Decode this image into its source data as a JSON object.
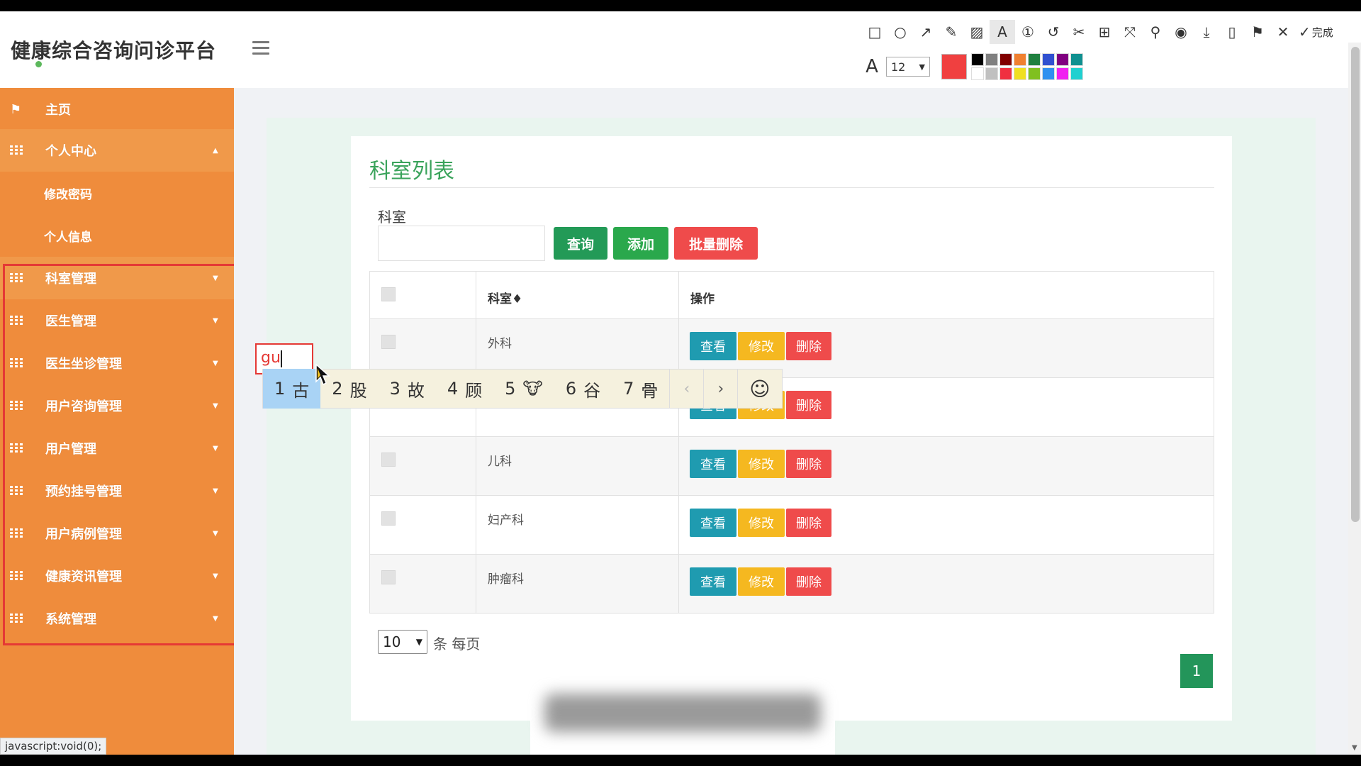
{
  "app": {
    "title": "健康综合咨询问诊平台"
  },
  "avatar": {
    "text": "80x80"
  },
  "annotation_toolbar": {
    "icons": [
      "rect-icon",
      "circle-icon",
      "arrow-icon",
      "pen-icon",
      "mosaic-icon",
      "text-icon",
      "number-icon",
      "undo-icon",
      "crop-icon",
      "translate-icon",
      "ocr-icon",
      "pin-icon",
      "record-icon",
      "download-icon",
      "save-icon",
      "bookmark-icon",
      "close-icon"
    ],
    "done_label": "完成",
    "font_size": "12",
    "current_color": "#f04040",
    "palette": [
      "#000000",
      "#808080",
      "#800000",
      "#f08030",
      "#208040",
      "#3050d0",
      "#800080",
      "#109090",
      "#ffffff",
      "#c0c0c0",
      "#f03040",
      "#f0e020",
      "#80c020",
      "#3090f0",
      "#f020f0",
      "#20d0d0"
    ]
  },
  "sidebar": {
    "items": [
      {
        "label": "主页",
        "icon": "flag-icon",
        "caret": ""
      },
      {
        "label": "个人中心",
        "icon": "grid-icon",
        "caret": "▲"
      },
      {
        "label": "修改密码",
        "sub": true
      },
      {
        "label": "个人信息",
        "sub": true
      },
      {
        "label": "科室管理",
        "icon": "grid-icon",
        "caret": "▼"
      },
      {
        "label": "医生管理",
        "icon": "grid-icon",
        "caret": "▼"
      },
      {
        "label": "医生坐诊管理",
        "icon": "grid-icon",
        "caret": "▼"
      },
      {
        "label": "用户咨询管理",
        "icon": "grid-icon",
        "caret": "▼"
      },
      {
        "label": "用户管理",
        "icon": "grid-icon",
        "caret": "▼"
      },
      {
        "label": "预约挂号管理",
        "icon": "grid-icon",
        "caret": "▼"
      },
      {
        "label": "用户病例管理",
        "icon": "grid-icon",
        "caret": "▼"
      },
      {
        "label": "健康资讯管理",
        "icon": "grid-icon",
        "caret": "▼"
      },
      {
        "label": "系统管理",
        "icon": "grid-icon",
        "caret": "▼"
      }
    ]
  },
  "status_url": "javascript:void(0);",
  "main": {
    "title": "科室列表",
    "search_label": "科室",
    "search_value": "",
    "buttons": {
      "query": "查询",
      "add": "添加",
      "batch_delete": "批量删除"
    },
    "table": {
      "headers": {
        "dept": "科室♦",
        "ops": "操作"
      },
      "rows": [
        {
          "dept": "外科"
        },
        {
          "dept": ""
        },
        {
          "dept": "儿科"
        },
        {
          "dept": "妇产科"
        },
        {
          "dept": "肿瘤科"
        }
      ],
      "op_labels": {
        "view": "查看",
        "edit": "修改",
        "delete": "删除"
      }
    },
    "pager": {
      "page_size": "10",
      "suffix": "条 每页",
      "current_page": "1"
    }
  },
  "ime": {
    "typed": "gu",
    "candidates": [
      {
        "n": "1",
        "text": "古"
      },
      {
        "n": "2",
        "text": "股"
      },
      {
        "n": "3",
        "text": "故"
      },
      {
        "n": "4",
        "text": "顾"
      },
      {
        "n": "5",
        "text": "🐮"
      },
      {
        "n": "6",
        "text": "谷"
      },
      {
        "n": "7",
        "text": "骨"
      }
    ],
    "prev": "‹",
    "next": "›",
    "emoji": "☺"
  }
}
